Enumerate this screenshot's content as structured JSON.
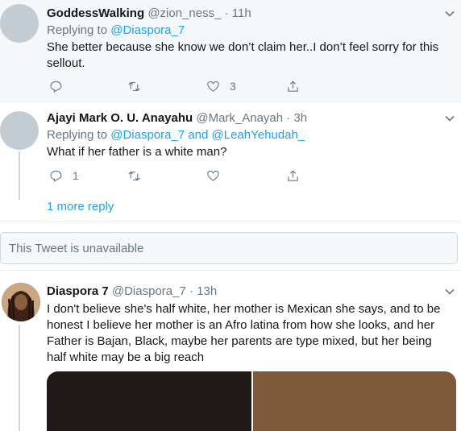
{
  "tweets": [
    {
      "name": "GoddessWalking",
      "handle": "@zion_ness_",
      "time": "· 11h",
      "replying_label": "Replying to",
      "replying_to": "@Diaspora_7",
      "text": "She better because she know we don’t claim her..I don’t feel sorry for this sellout.",
      "likes": "3"
    },
    {
      "name": "Ajayi Mark O. U. Anayahu",
      "handle": "@Mark_Anayah",
      "time": "· 3h",
      "replying_label": "Replying to",
      "replying_to": "@Diaspora_7 and @LeahYehudah_",
      "text": "What if her father is a white man?",
      "replies": "1"
    },
    {
      "name": "Diaspora 7",
      "handle": "@Diaspora_7",
      "time": "· 13h",
      "text": "I don't believe she's half white, her mother is Mexican she says, and to be honest I believe her mother is an Afro latina from how she looks, and her Father is Bajan, Black, maybe her parents are type mixed, but her being half white may be a big reach"
    }
  ],
  "more_replies": "1 more reply",
  "unavailable": "This Tweet is unavailable",
  "icons": {
    "caret": "chevron-down-icon",
    "reply": "reply-icon",
    "retweet": "retweet-icon",
    "like": "heart-icon",
    "share": "share-icon"
  },
  "colors": {
    "link": "#1da1f2",
    "muted": "#657786",
    "highlight_bg": "#f5f8fa"
  }
}
